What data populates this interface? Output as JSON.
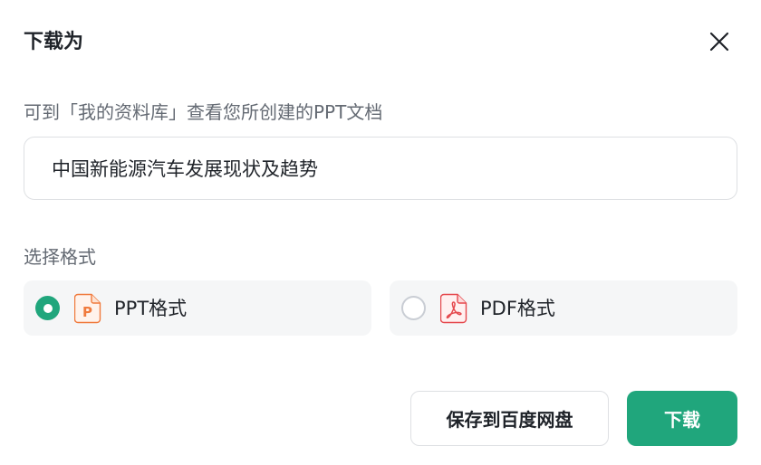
{
  "dialog": {
    "title": "下载为",
    "hint": "可到「我的资料库」查看您所创建的PPT文档",
    "file_name_value": "中国新能源汽车发展现状及趋势",
    "format_label": "选择格式",
    "options": [
      {
        "label": "PPT格式",
        "selected": true,
        "icon": "ppt-file-icon",
        "icon_letter": "P",
        "color": "#f07a3c"
      },
      {
        "label": "PDF格式",
        "selected": false,
        "icon": "pdf-file-icon",
        "color": "#e5484d"
      }
    ],
    "save_button_label": "保存到百度网盘",
    "download_button_label": "下载"
  },
  "colors": {
    "accent": "#20a67c",
    "text_primary": "#1f2329",
    "text_secondary": "#646a73",
    "border": "#dee0e3",
    "option_background": "#f5f6f7"
  }
}
